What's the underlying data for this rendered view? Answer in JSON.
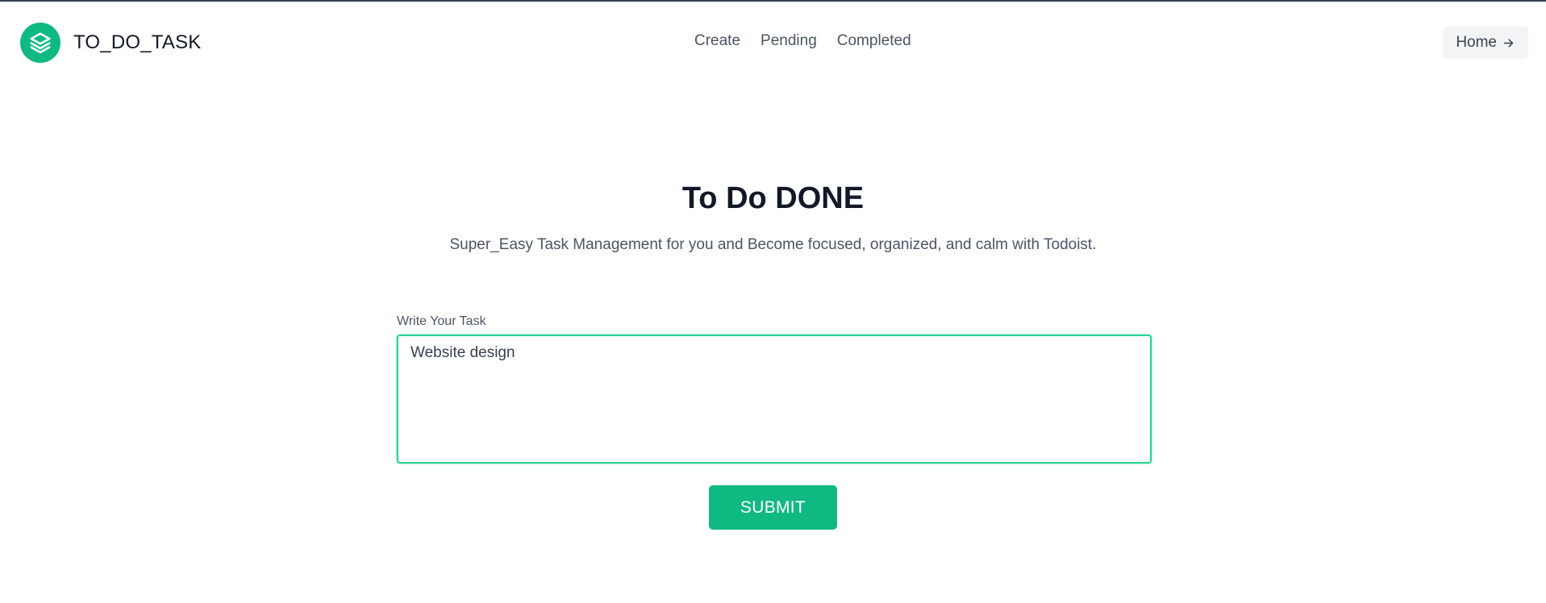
{
  "brand": {
    "name": "TO_DO_TASK",
    "logo_icon": "layers-icon",
    "logo_color": "#10b981"
  },
  "nav": {
    "items": [
      {
        "label": "Create"
      },
      {
        "label": "Pending"
      },
      {
        "label": "Completed"
      }
    ]
  },
  "home_button": {
    "label": "Home",
    "icon": "arrow-right-icon"
  },
  "hero": {
    "title": "To Do DONE",
    "subtitle": "Super_Easy Task Management for you and Become focused, organized, and calm with Todoist."
  },
  "form": {
    "label": "Write Your Task",
    "task_value": "Website design",
    "submit_label": "SUBMIT"
  },
  "colors": {
    "accent": "#10b981",
    "focus_border": "#34d399",
    "text_primary": "#111827",
    "text_secondary": "#4b5563"
  }
}
